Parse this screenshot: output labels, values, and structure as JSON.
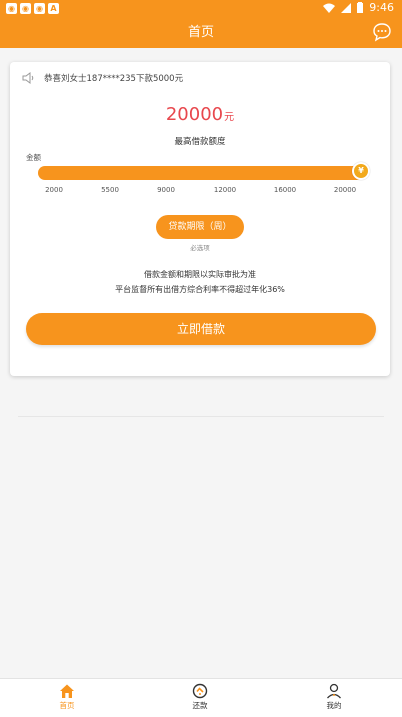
{
  "statusbar": {
    "time": "9:46",
    "notification_icons": [
      "app-icon",
      "app-icon",
      "app-icon",
      "a-icon"
    ]
  },
  "header": {
    "title": "首页",
    "chat_icon": "chat-bubble-icon"
  },
  "notice": {
    "icon": "speaker-icon",
    "text": "恭喜刘女士187****235下款5000元"
  },
  "loan": {
    "amount": "20000",
    "unit": "元",
    "max_label": "最高借款额度",
    "amount_label": "金额",
    "slider_level": 1.0,
    "thumb_glyph": "¥",
    "ticks": [
      "2000",
      "5500",
      "9000",
      "12000",
      "16000",
      "20000"
    ]
  },
  "period": {
    "button_label": "贷款期限（周）",
    "required_text": "必选项"
  },
  "notes": {
    "line1": "借款金额和期限以实际审批为准",
    "line2": "平台监督所有出借方综合利率不得超过年化36%"
  },
  "actions": {
    "borrow_label": "立即借款"
  },
  "tabs": [
    {
      "label": "首页",
      "icon": "home-icon",
      "active": true
    },
    {
      "label": "还款",
      "icon": "repay-icon",
      "active": false
    },
    {
      "label": "我的",
      "icon": "user-icon",
      "active": false
    }
  ],
  "colors": {
    "brand": "#f7941d",
    "amount": "#e8474d"
  }
}
